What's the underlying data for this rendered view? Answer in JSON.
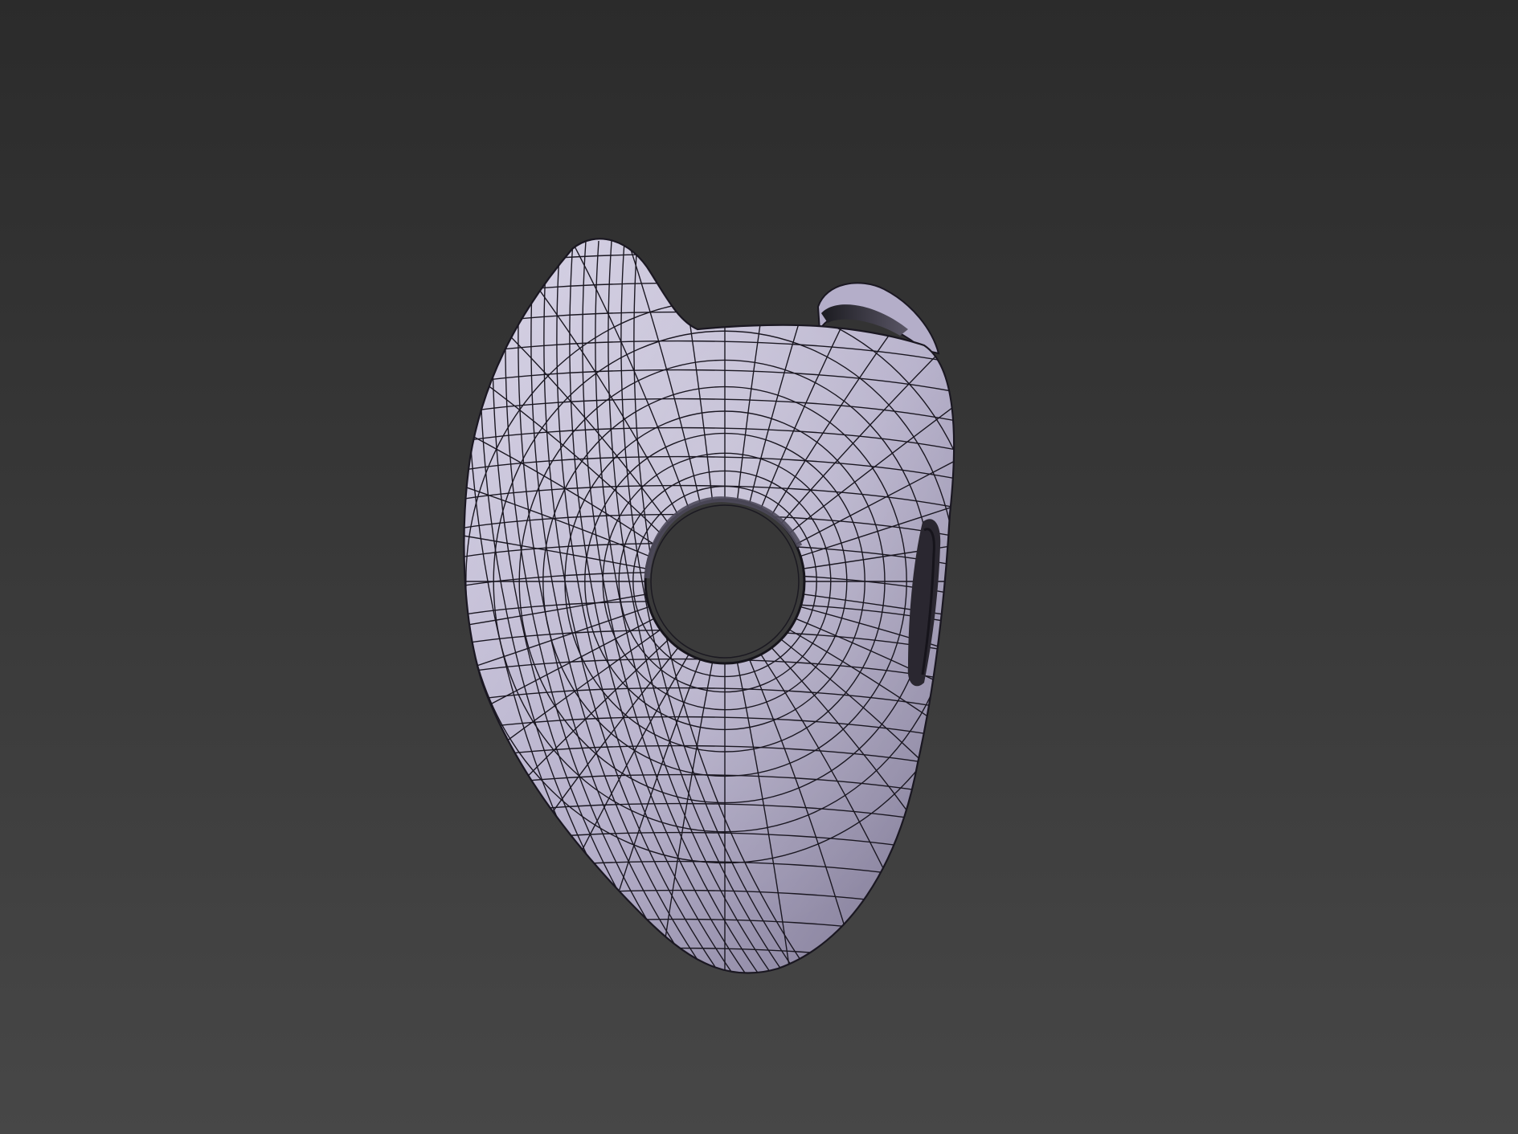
{
  "viewport": {
    "background_top": "#2b2b2b",
    "background_bottom": "#474747"
  },
  "model": {
    "name": "mask-mesh",
    "shape": "mask-with-round-eye-hole",
    "material_color": "#b4aec9",
    "material_highlight": "#d7d3e6",
    "material_shadow": "#7e7893",
    "wireframe_color": "#1a1721",
    "show_wireframe": true
  }
}
